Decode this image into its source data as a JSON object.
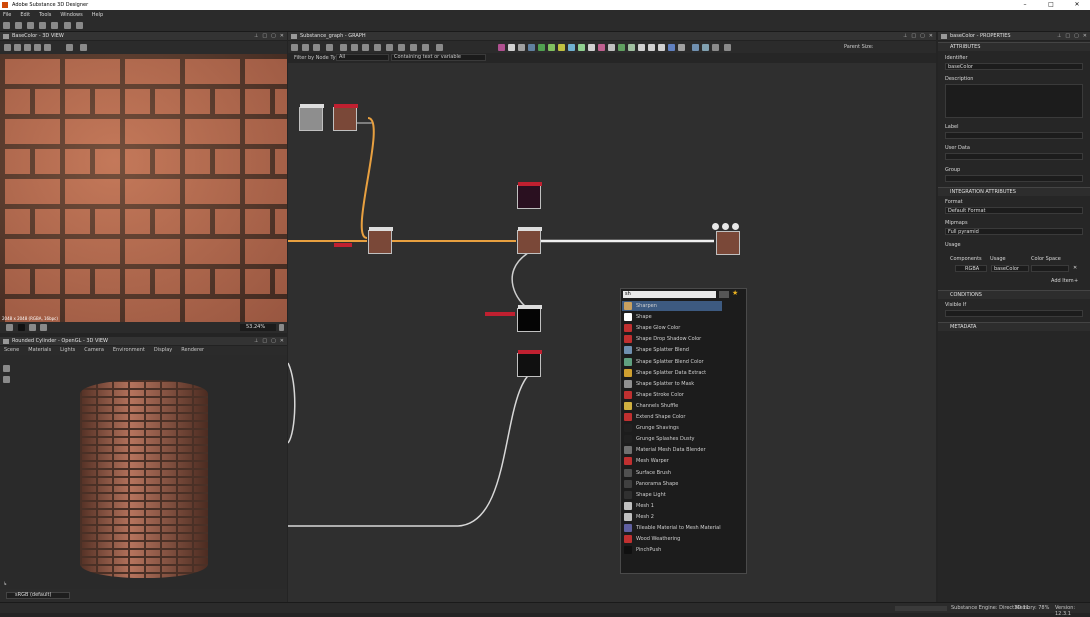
{
  "app": {
    "title": "Adobe Substance 3D Designer"
  },
  "menu": [
    "File",
    "Edit",
    "Tools",
    "Windows",
    "Help"
  ],
  "left_top": {
    "title": "BaseColor - 3D VIEW",
    "resolution": "2048 x 2048 (RGBA, 16bpc)",
    "zoom": "53.24%"
  },
  "left_bottom": {
    "title": "Rounded Cylinder - OpenGL - 3D VIEW",
    "tabs": [
      "Scene",
      "Materials",
      "Lights",
      "Camera",
      "Environment",
      "Display",
      "Renderer"
    ],
    "colorspace": "sRGB (default)"
  },
  "graph": {
    "title": "Substance_graph - GRAPH",
    "filter_label": "Filter by Node Type:",
    "filter_value": "All",
    "text_filter": "Containing text or variable",
    "parent_size": "Parent Size:"
  },
  "search_popup": {
    "query": "sh",
    "items": [
      {
        "label": "Sharpen",
        "color": "#c8a060"
      },
      {
        "label": "Shape",
        "color": "#ffffff"
      },
      {
        "label": "Shape Glow Color",
        "color": "#c03030"
      },
      {
        "label": "Shape Drop Shadow Color",
        "color": "#c03030"
      },
      {
        "label": "Shape Splatter Blend",
        "color": "#7090b0"
      },
      {
        "label": "Shape Splatter Blend Color",
        "color": "#60a080"
      },
      {
        "label": "Shape Splatter Data Extract",
        "color": "#d0a030"
      },
      {
        "label": "Shape Splatter to Mask",
        "color": "#909090"
      },
      {
        "label": "Shape Stroke Color",
        "color": "#c03030"
      },
      {
        "label": "Channels Shuffle",
        "color": "#d0b040"
      },
      {
        "label": "Extend Shape Color",
        "color": "#c03030"
      },
      {
        "label": "Grunge Shavings",
        "color": "#202020"
      },
      {
        "label": "Grunge Splashes Dusty",
        "color": "#202020"
      },
      {
        "label": "Material Mesh Data Blender",
        "color": "#707070"
      },
      {
        "label": "Mesh Warper",
        "color": "#c03030"
      },
      {
        "label": "Surface Brush",
        "color": "#505050"
      },
      {
        "label": "Panorama Shape",
        "color": "#404040"
      },
      {
        "label": "Shape Light",
        "color": "#303030"
      },
      {
        "label": "Mesh 1",
        "color": "#c0c0c0"
      },
      {
        "label": "Mesh 2",
        "color": "#c0c0c0"
      },
      {
        "label": "Tileable Material to Mesh Material",
        "color": "#6060a0"
      },
      {
        "label": "Wood Weathering",
        "color": "#c03030"
      },
      {
        "label": "PinchPush",
        "color": "#101010"
      }
    ]
  },
  "properties": {
    "title": "baseColor - PROPERTIES",
    "sections": {
      "attributes": "ATTRIBUTES",
      "integration": "INTEGRATION ATTRIBUTES",
      "conditions": "CONDITIONS",
      "metadata": "METADATA"
    },
    "identifier_label": "Identifier",
    "identifier_value": "baseColor",
    "description_label": "Description",
    "label_label": "Label",
    "userdata_label": "User Data",
    "group_label": "Group",
    "format_label": "Format",
    "format_value": "Default Format",
    "mipmaps_label": "Mipmaps",
    "mipmaps_value": "Full pyramid",
    "usage_label": "Usage",
    "components_label": "Components",
    "usage_col_label": "Usage",
    "colorspace_label": "Color Space",
    "components_value": "RGBA",
    "usage_value": "baseColor",
    "add_item": "Add Item",
    "visible_if_label": "Visible If"
  },
  "status": {
    "engine": "Substance Engine: Direct3D 11",
    "memory": "Memory: 78%",
    "version": "Version: 12.3.1"
  }
}
